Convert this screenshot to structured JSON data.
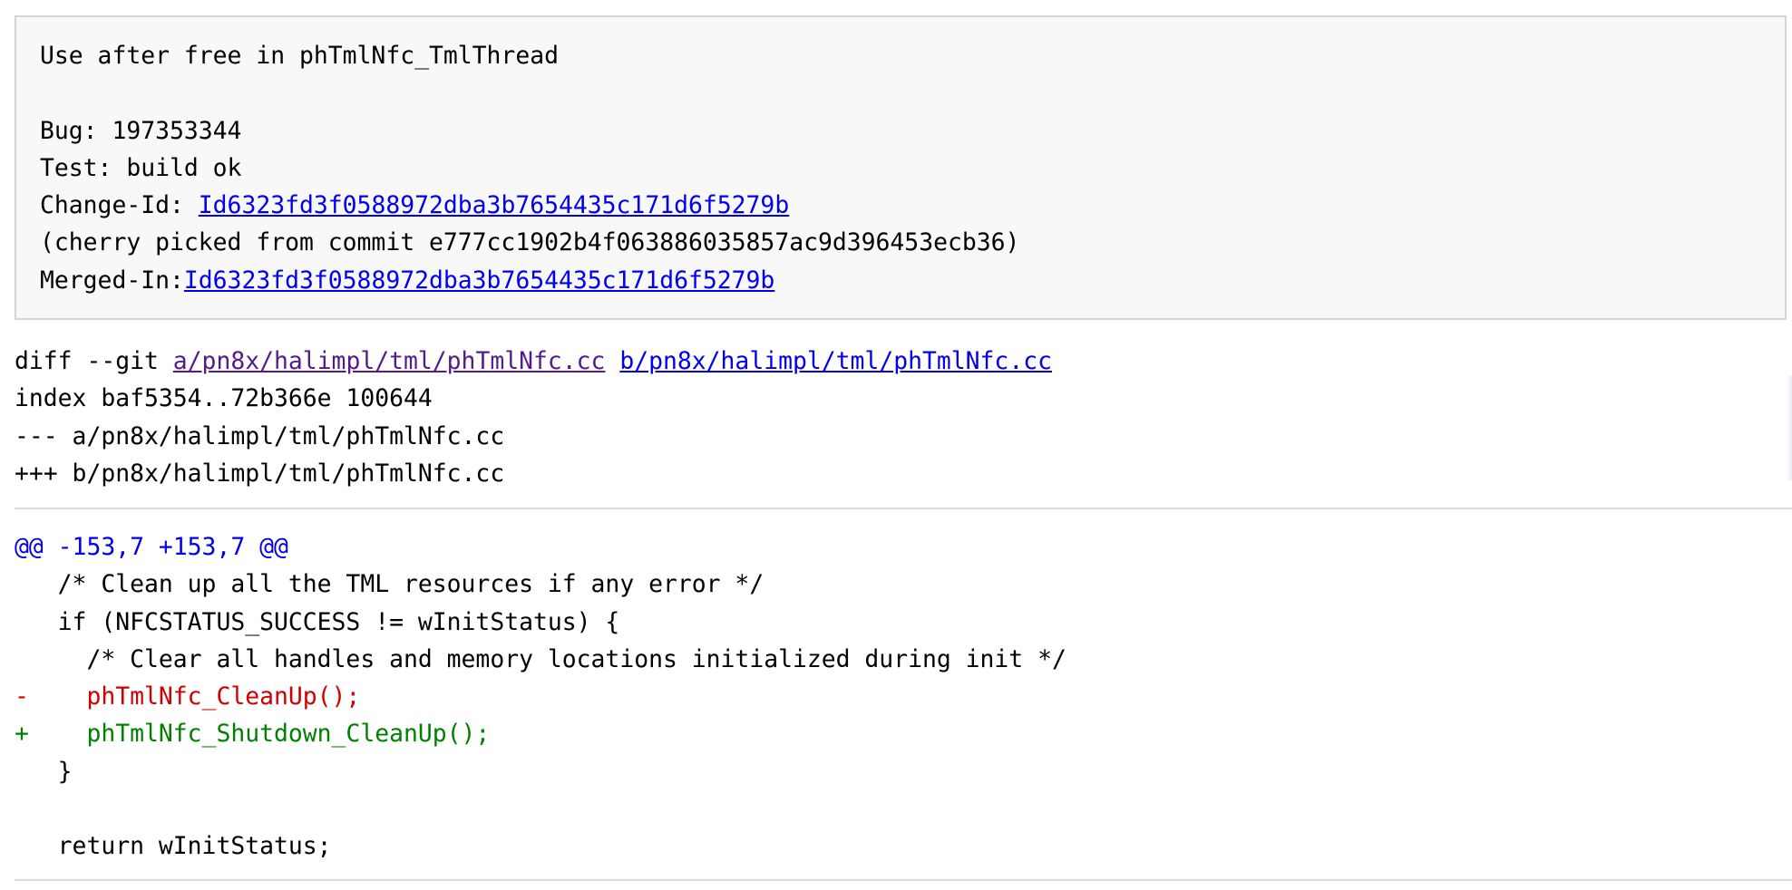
{
  "commit_message": {
    "subject": "Use after free in phTmlNfc_TmlThread",
    "bug": "Bug: 197353344",
    "test": "Test: build ok",
    "change_id_label": "Change-Id: ",
    "change_id": "Id6323fd3f0588972dba3b7654435c171d6f5279b",
    "cherry_pick": "(cherry picked from commit e777cc1902b4f063886035857ac9d396453ecb36)",
    "merged_in_label": "Merged-In:",
    "merged_in": "Id6323fd3f0588972dba3b7654435c171d6f5279b"
  },
  "diff_header": {
    "diff_git_prefix": "diff --git ",
    "path_a": "a/pn8x/halimpl/tml/phTmlNfc.cc",
    "path_b": "b/pn8x/halimpl/tml/phTmlNfc.cc",
    "index": "index baf5354..72b366e 100644",
    "minus_file": "--- a/pn8x/halimpl/tml/phTmlNfc.cc",
    "plus_file": "+++ b/pn8x/halimpl/tml/phTmlNfc.cc"
  },
  "hunk": {
    "header": "@@ -153,7 +153,7 @@",
    "lines": [
      {
        "type": "context",
        "text": "   /* Clean up all the TML resources if any error */"
      },
      {
        "type": "context",
        "text": "   if (NFCSTATUS_SUCCESS != wInitStatus) {"
      },
      {
        "type": "context",
        "text": "     /* Clear all handles and memory locations initialized during init */"
      },
      {
        "type": "del",
        "text": "-    phTmlNfc_CleanUp();"
      },
      {
        "type": "add",
        "text": "+    phTmlNfc_Shutdown_CleanUp();"
      },
      {
        "type": "context",
        "text": "   }"
      },
      {
        "type": "context",
        "text": " "
      },
      {
        "type": "context",
        "text": "   return wInitStatus;"
      }
    ]
  },
  "colors": {
    "link": "#0000ee",
    "visited": "#551a8b",
    "deletion": "#d00000",
    "addition": "#008000"
  }
}
